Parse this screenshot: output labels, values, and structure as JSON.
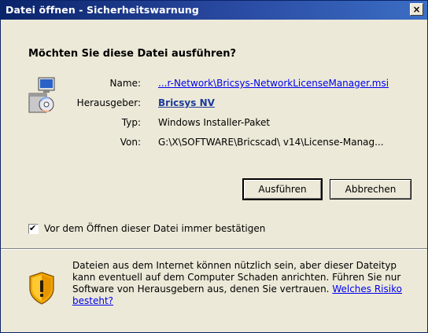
{
  "window": {
    "title": "Datei öffnen - Sicherheitswarnung",
    "close_label": "×"
  },
  "question": "Möchten Sie diese Datei ausführen?",
  "info": {
    "name_label": "Name:",
    "name_value": "...r-Network\\Bricsys-NetworkLicenseManager.msi",
    "publisher_label": "Herausgeber:",
    "publisher_value": "Bricsys NV",
    "type_label": "Typ:",
    "type_value": "Windows Installer-Paket",
    "from_label": "Von:",
    "from_value": "G:\\X\\SOFTWARE\\Bricscad\\ v14\\License-Manag..."
  },
  "buttons": {
    "run": "Ausführen",
    "cancel": "Abbrechen"
  },
  "checkbox": {
    "label": "Vor dem Öffnen dieser Datei immer bestätigen",
    "checked": true,
    "mark": "✔"
  },
  "warning": {
    "text": "Dateien aus dem Internet können nützlich sein, aber dieser Dateityp kann eventuell auf dem Computer Schaden anrichten. Führen Sie nur Software von Herausgebern aus, denen Sie vertrauen. ",
    "link": "Welches Risiko besteht?"
  }
}
